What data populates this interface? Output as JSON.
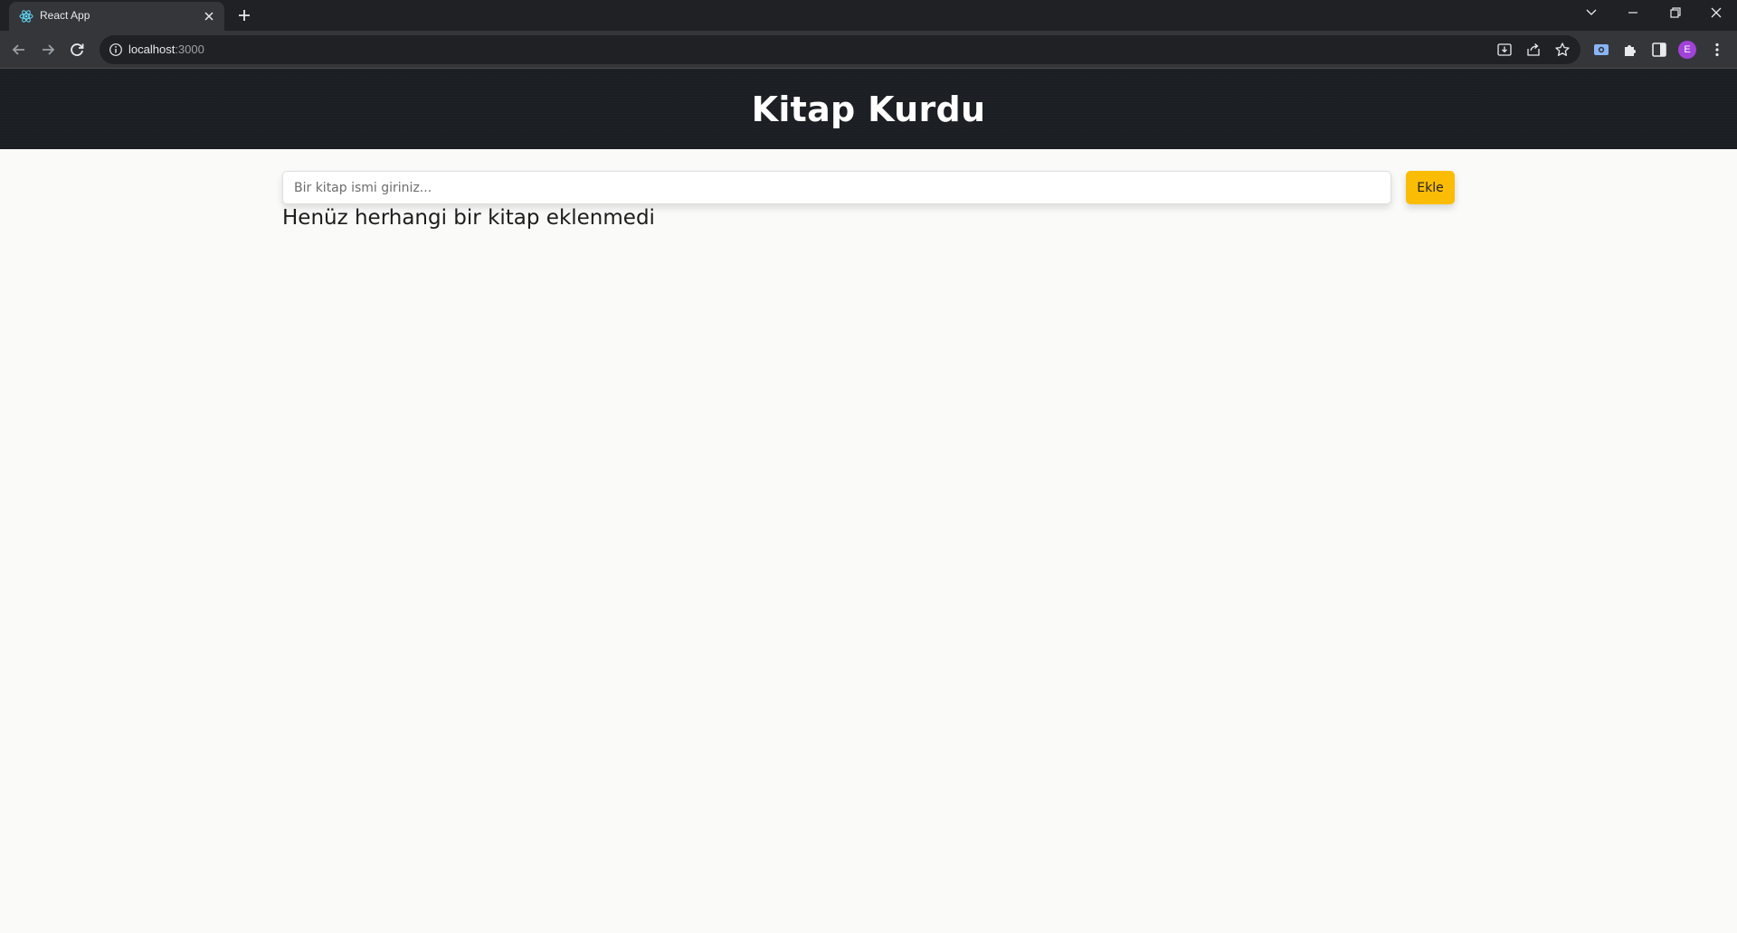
{
  "browser": {
    "tab": {
      "title": "React App"
    },
    "address": {
      "host": "localhost",
      "port": ":3000"
    },
    "profile_initial": "E",
    "colors": {
      "frame": "#1f2124",
      "toolbar": "#35363a",
      "omnibox": "#202124",
      "avatar": "#a142d8"
    }
  },
  "app": {
    "title": "Kitap Kurdu",
    "input_placeholder": "Bir kitap ismi giriniz...",
    "add_button_label": "Ekle",
    "empty_message": "Henüz herhangi bir kitap eklenmedi",
    "colors": {
      "header": "#1b1f23",
      "button": "#fbbc05",
      "background": "#fafaf9"
    }
  }
}
